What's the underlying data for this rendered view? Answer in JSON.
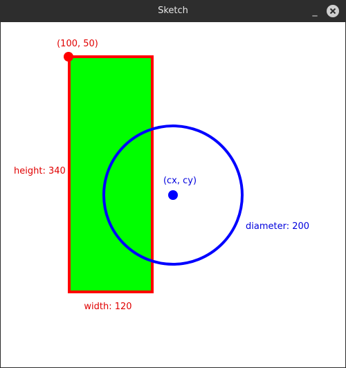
{
  "window": {
    "title": "Sketch",
    "minimize_glyph": "_",
    "close_icon": "close-icon"
  },
  "sketch": {
    "origin_label": "(100, 50)",
    "height_label": "height: 340",
    "width_label": "width: 120",
    "center_label": "(cx, cy)",
    "diameter_label": "diameter: 200",
    "colors": {
      "rect_fill": "#00ff00",
      "rect_stroke": "#ff0000",
      "circle_stroke": "#0000ff",
      "red_text": "#e00000",
      "blue_text": "#0000dd"
    }
  }
}
